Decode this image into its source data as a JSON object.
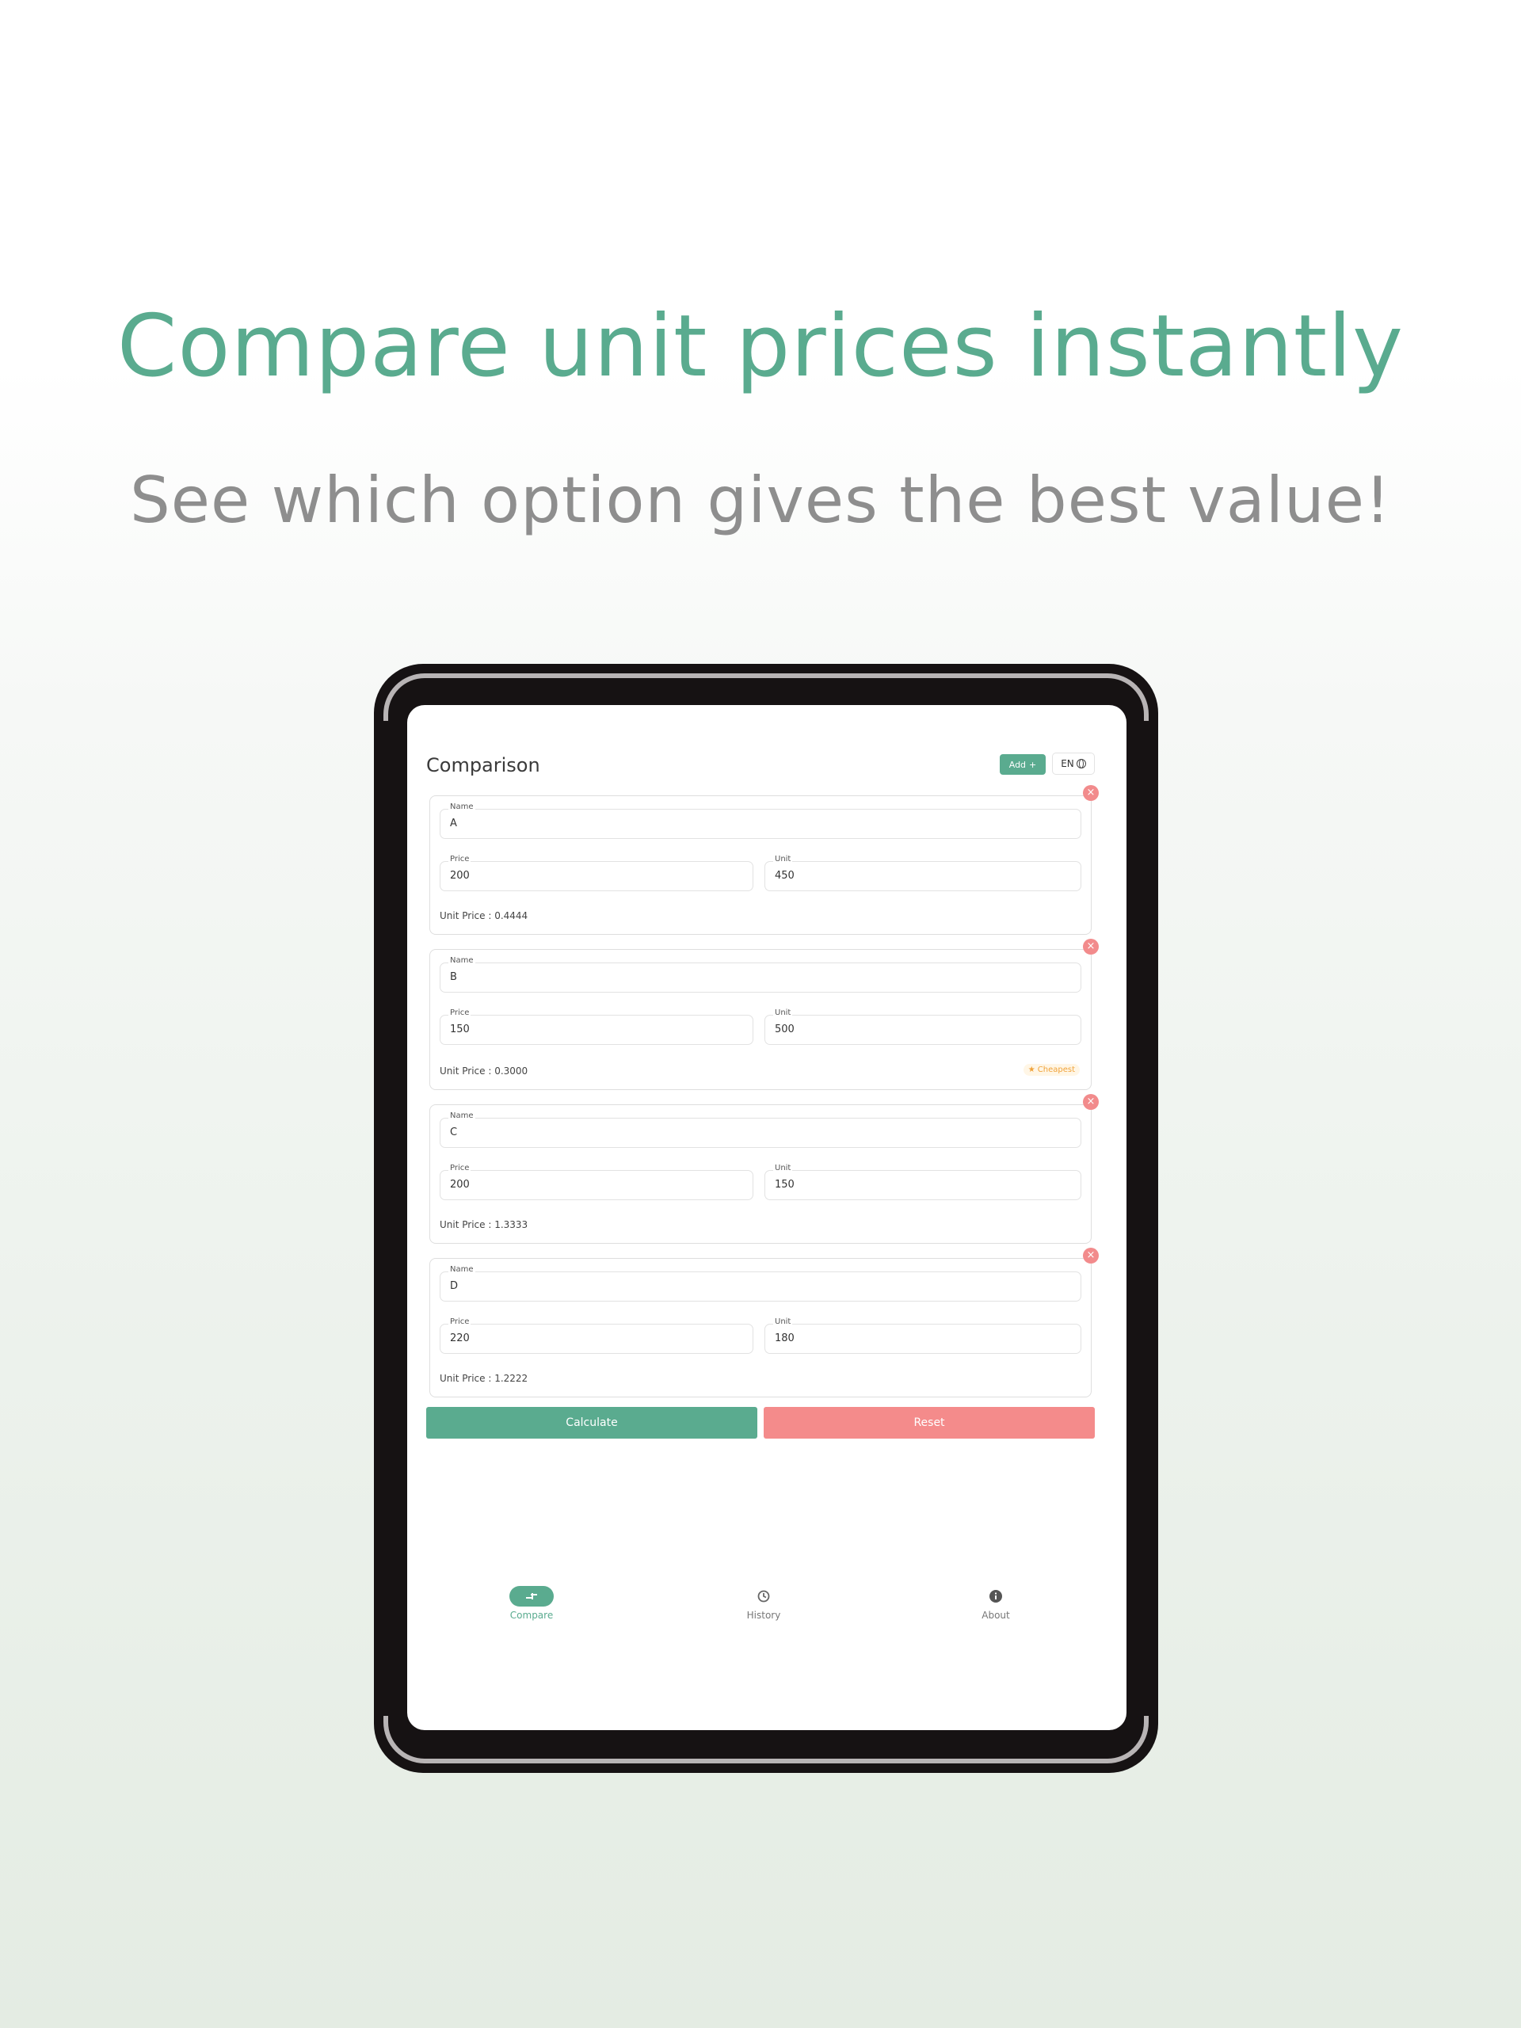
{
  "headline": "Compare unit prices instantly",
  "subheadline": "See which option gives the best value!",
  "app": {
    "title": "Comparison",
    "add_label": "Add",
    "lang_label": "EN",
    "items": [
      {
        "name_label": "Name",
        "name": "A",
        "price_label": "Price",
        "price": "200",
        "unit_label": "Unit",
        "unit": "450",
        "unit_price": "Unit Price : 0.4444",
        "cheapest": false
      },
      {
        "name_label": "Name",
        "name": "B",
        "price_label": "Price",
        "price": "150",
        "unit_label": "Unit",
        "unit": "500",
        "unit_price": "Unit Price : 0.3000",
        "cheapest": true,
        "cheapest_label": "Cheapest"
      },
      {
        "name_label": "Name",
        "name": "C",
        "price_label": "Price",
        "price": "200",
        "unit_label": "Unit",
        "unit": "150",
        "unit_price": "Unit Price : 1.3333",
        "cheapest": false
      },
      {
        "name_label": "Name",
        "name": "D",
        "price_label": "Price",
        "price": "220",
        "unit_label": "Unit",
        "unit": "180",
        "unit_price": "Unit Price : 1.2222",
        "cheapest": false
      }
    ],
    "calculate_label": "Calculate",
    "reset_label": "Reset",
    "nav": [
      {
        "label": "Compare",
        "icon": "compare-icon",
        "active": true
      },
      {
        "label": "History",
        "icon": "history-icon",
        "active": false
      },
      {
        "label": "About",
        "icon": "info-icon",
        "active": false
      }
    ]
  },
  "colors": {
    "accent": "#5aab8f",
    "danger": "#f48b8b",
    "badge": "#f0a33a",
    "subtitle": "#8e8e8e"
  }
}
